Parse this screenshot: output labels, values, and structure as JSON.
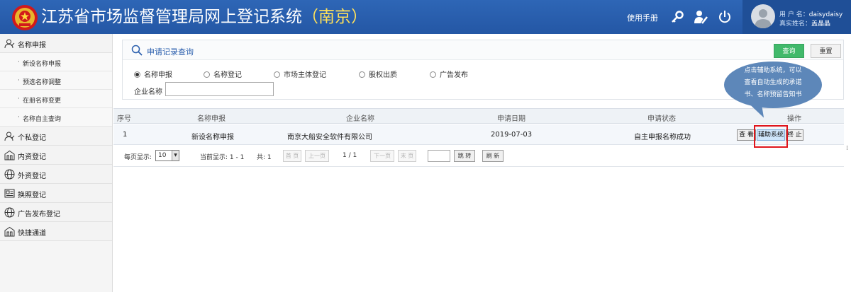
{
  "header": {
    "title": "江苏省市场监督管理局网上登记系统",
    "city": "（南京）",
    "manual": "使用手册",
    "icons": [
      "key-icon",
      "user-edit-icon",
      "power-icon"
    ],
    "user_label": "用 户 名：",
    "user_name": "daisydaisy",
    "real_label": "真实姓名：",
    "real_name": "盖晶晶"
  },
  "sidebar": {
    "items": [
      {
        "label": "名称申报",
        "icon": "user-outline-icon"
      },
      {
        "label": "新设名称申报"
      },
      {
        "label": "预选名称调整"
      },
      {
        "label": "在册名称变更"
      },
      {
        "label": "名称自主查询"
      },
      {
        "label": "个私登记",
        "icon": "user-outline-icon"
      },
      {
        "label": "内资登记",
        "icon": "building-icon"
      },
      {
        "label": "外资登记",
        "icon": "globe-icon"
      },
      {
        "label": "换照登记",
        "icon": "license-icon"
      },
      {
        "label": "广告发布登记",
        "icon": "globe-icon"
      },
      {
        "label": "快捷通道",
        "icon": "building-icon"
      }
    ]
  },
  "search": {
    "title": "申请记录查询",
    "query_button": "查询",
    "reset_button": "重置",
    "radios": [
      {
        "label": "名称申报",
        "checked": true
      },
      {
        "label": "名称登记",
        "checked": false
      },
      {
        "label": "市场主体登记",
        "checked": false
      },
      {
        "label": "股权出质",
        "checked": false
      },
      {
        "label": "广告发布",
        "checked": false
      }
    ],
    "enterprise_label": "企业名称",
    "enterprise_value": ""
  },
  "table": {
    "headers": [
      "序号",
      "名称申报",
      "企业名称",
      "申请日期",
      "申请状态",
      "操作"
    ],
    "rows": [
      {
        "index": "1",
        "type": "新设名称申报",
        "company": "南京大船安全软件有限公司",
        "date": "2019-07-03",
        "status": "自主申报名称成功"
      }
    ],
    "actions": {
      "view": "查 看",
      "assist": "辅助系统",
      "end": "终 止"
    }
  },
  "pager": {
    "per_page_label": "每页显示:",
    "per_page_value": "10",
    "current_label": "当前显示: 1 - 1",
    "total_label": "共: 1",
    "first": "首 页",
    "prev": "上一页",
    "page_info": "1 / 1",
    "next": "下一页",
    "last": "末 页",
    "jump": "跳 转",
    "refresh": "刷 新"
  },
  "tooltip": {
    "line1": "点击辅助系统，可以",
    "line2": "查看自动生成的承诺",
    "line3": "书、名称预留告知书"
  },
  "colors": {
    "header_bg": "#2e66b6",
    "accent_green": "#41b96b",
    "highlight_red": "#e0141b",
    "tooltip_bg": "#5d87b9"
  }
}
